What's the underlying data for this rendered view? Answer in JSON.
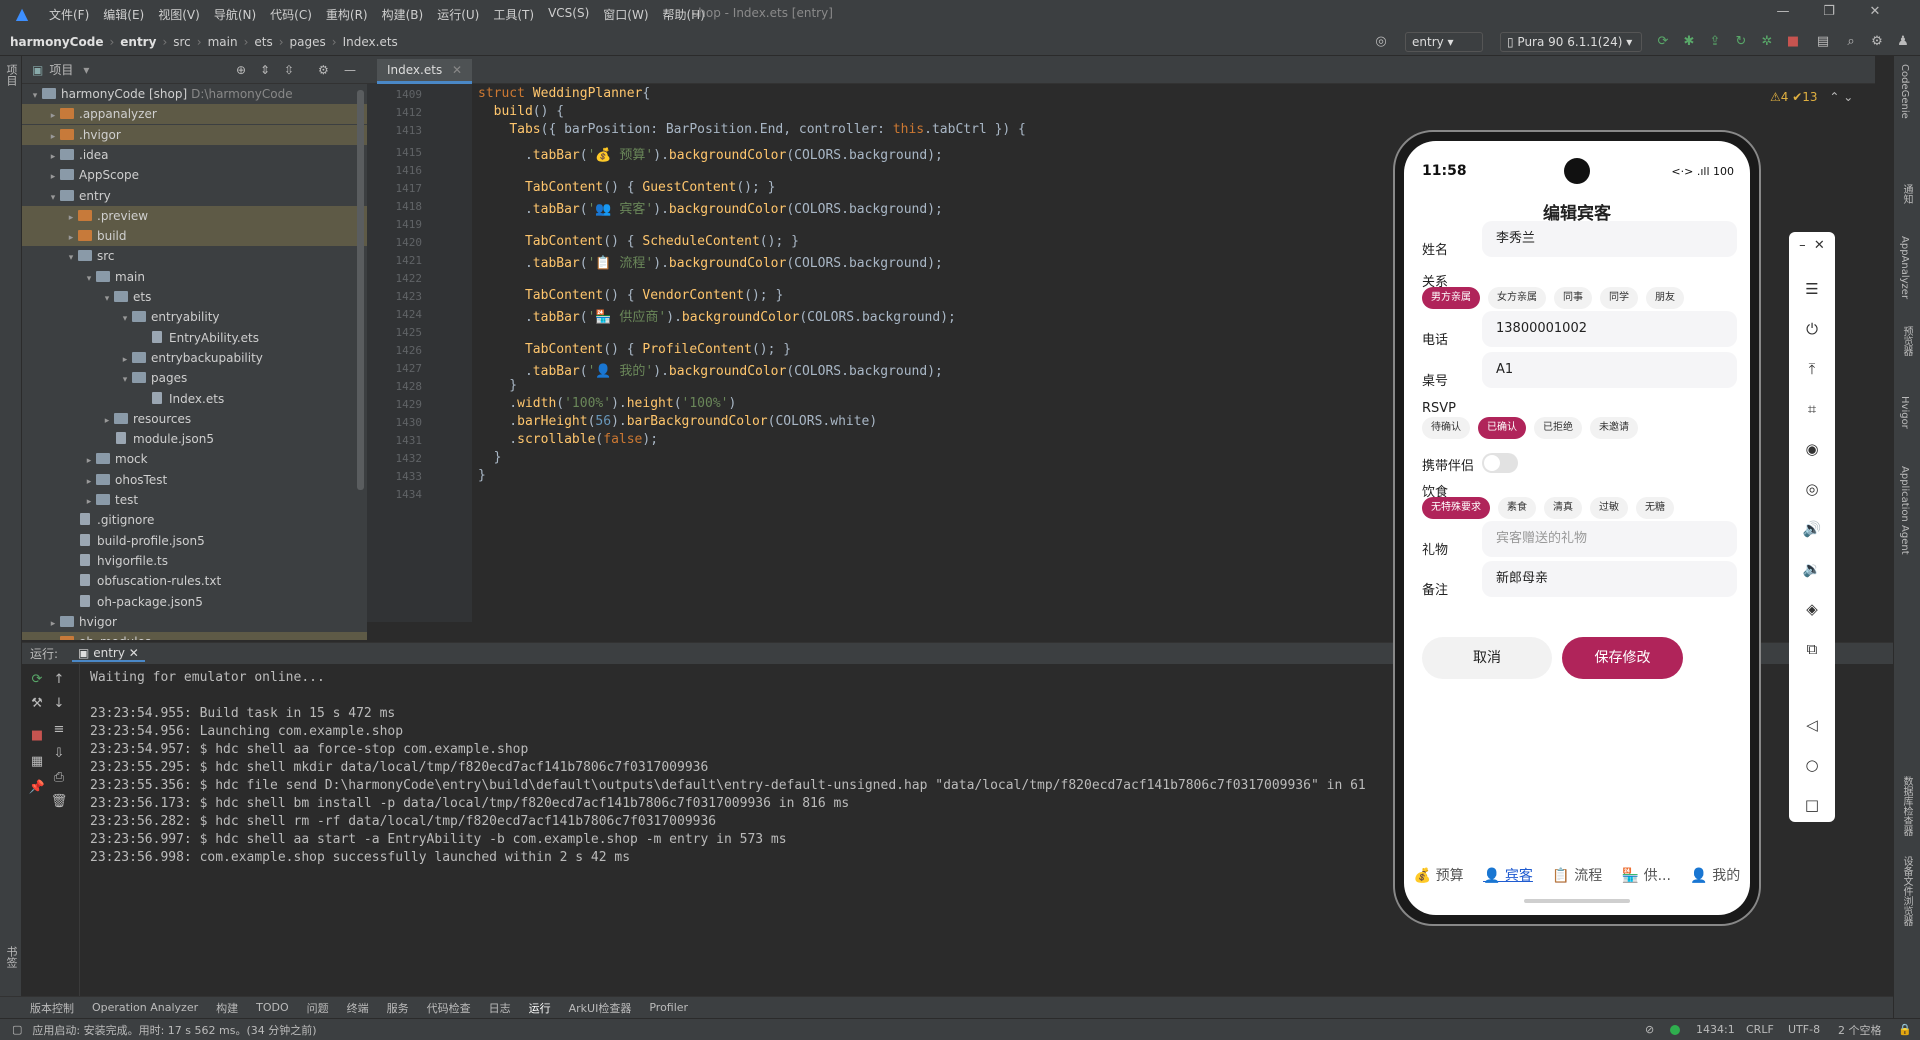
{
  "menu": {
    "items": [
      "文件(F)",
      "编辑(E)",
      "视图(V)",
      "导航(N)",
      "代码(C)",
      "重构(R)",
      "构建(B)",
      "运行(U)",
      "工具(T)",
      "VCS(S)",
      "窗口(W)",
      "帮助(H)"
    ],
    "title": "shop - Index.ets [entry]"
  },
  "nav": {
    "crumbs": [
      "harmonyCode",
      "entry",
      "src",
      "main",
      "ets",
      "pages",
      "Index.ets"
    ],
    "run_config": "entry",
    "device": "Pura 90 6.1.1(24)"
  },
  "left_strip": {
    "project": "项目",
    "bookmarks": "书签",
    "structure": "结构"
  },
  "project": {
    "header": "项目",
    "tree": [
      {
        "indent": 0,
        "arrow": "▾",
        "icon": "fold",
        "name": "harmonyCode [shop]",
        "extra": "D:\\harmonyCode",
        "hl": false
      },
      {
        "indent": 1,
        "arrow": "▸",
        "icon": "ofold",
        "name": ".appanalyzer",
        "hl": true
      },
      {
        "indent": 1,
        "arrow": "▸",
        "icon": "ofold",
        "name": ".hvigor",
        "hl": true
      },
      {
        "indent": 1,
        "arrow": "▸",
        "icon": "fold",
        "name": ".idea",
        "hl": false
      },
      {
        "indent": 1,
        "arrow": "▸",
        "icon": "fold",
        "name": "AppScope",
        "hl": false
      },
      {
        "indent": 1,
        "arrow": "▾",
        "icon": "fold",
        "name": "entry",
        "hl": false
      },
      {
        "indent": 2,
        "arrow": "▸",
        "icon": "ofold",
        "name": ".preview",
        "hl": true
      },
      {
        "indent": 2,
        "arrow": "▸",
        "icon": "ofold",
        "name": "build",
        "hl": true
      },
      {
        "indent": 2,
        "arrow": "▾",
        "icon": "fold",
        "name": "src",
        "hl": false
      },
      {
        "indent": 3,
        "arrow": "▾",
        "icon": "fold",
        "name": "main",
        "hl": false
      },
      {
        "indent": 4,
        "arrow": "▾",
        "icon": "fold",
        "name": "ets",
        "hl": false
      },
      {
        "indent": 5,
        "arrow": "▾",
        "icon": "fold",
        "name": "entryability",
        "hl": false
      },
      {
        "indent": 6,
        "arrow": "",
        "icon": "file",
        "name": "EntryAbility.ets",
        "hl": false
      },
      {
        "indent": 5,
        "arrow": "▸",
        "icon": "fold",
        "name": "entrybackupability",
        "hl": false
      },
      {
        "indent": 5,
        "arrow": "▾",
        "icon": "fold",
        "name": "pages",
        "hl": false
      },
      {
        "indent": 6,
        "arrow": "",
        "icon": "file",
        "name": "Index.ets",
        "hl": false
      },
      {
        "indent": 4,
        "arrow": "▸",
        "icon": "fold",
        "name": "resources",
        "hl": false
      },
      {
        "indent": 4,
        "arrow": "",
        "icon": "file",
        "name": "module.json5",
        "hl": false
      },
      {
        "indent": 3,
        "arrow": "▸",
        "icon": "fold",
        "name": "mock",
        "hl": false
      },
      {
        "indent": 3,
        "arrow": "▸",
        "icon": "fold",
        "name": "ohosTest",
        "hl": false
      },
      {
        "indent": 3,
        "arrow": "▸",
        "icon": "fold",
        "name": "test",
        "hl": false
      },
      {
        "indent": 2,
        "arrow": "",
        "icon": "file",
        "name": ".gitignore",
        "hl": false
      },
      {
        "indent": 2,
        "arrow": "",
        "icon": "file",
        "name": "build-profile.json5",
        "hl": false
      },
      {
        "indent": 2,
        "arrow": "",
        "icon": "file",
        "name": "hvigorfile.ts",
        "hl": false
      },
      {
        "indent": 2,
        "arrow": "",
        "icon": "file",
        "name": "obfuscation-rules.txt",
        "hl": false
      },
      {
        "indent": 2,
        "arrow": "",
        "icon": "file",
        "name": "oh-package.json5",
        "hl": false
      },
      {
        "indent": 1,
        "arrow": "▸",
        "icon": "fold",
        "name": "hvigor",
        "hl": false
      },
      {
        "indent": 1,
        "arrow": "▸",
        "icon": "ofold",
        "name": "oh_modules",
        "hl": true
      }
    ]
  },
  "editor": {
    "tab": "Index.ets",
    "inspections": "⚠4 ✔13",
    "line_numbers": [
      "1409",
      "1412",
      "1413",
      "1415",
      "1416",
      "1417",
      "1418",
      "1419",
      "1420",
      "1421",
      "1422",
      "1423",
      "1424",
      "1425",
      "1426",
      "1427",
      "1428",
      "1429",
      "1430",
      "1431",
      "1432",
      "1433",
      "1434"
    ],
    "lines": [
      [
        [
          "kw",
          "struct "
        ],
        [
          "fn",
          "WeddingPlanner"
        ],
        [
          "",
          "{"
        ]
      ],
      [
        [
          "",
          "  "
        ],
        [
          "fn",
          "build"
        ],
        [
          "",
          "() {"
        ]
      ],
      [
        [
          "",
          "    "
        ],
        [
          "fn",
          "Tabs"
        ],
        [
          "",
          "({ barPosition: BarPosition.End, controller: "
        ],
        [
          "kw",
          "this"
        ],
        [
          "",
          ".tabCtrl }) {"
        ]
      ],
      [
        [
          "",
          "      ."
        ],
        [
          "fn",
          "tabBar"
        ],
        [
          "",
          "("
        ],
        [
          "st",
          "'💰 预算'"
        ],
        [
          "",
          ")."
        ],
        [
          "fn",
          "backgroundColor"
        ],
        [
          "",
          "(COLORS.background);"
        ]
      ],
      [
        [
          "",
          ""
        ]
      ],
      [
        [
          "",
          "      "
        ],
        [
          "fn",
          "TabContent"
        ],
        [
          "",
          "() { "
        ],
        [
          "fn",
          "GuestContent"
        ],
        [
          "",
          "(); }"
        ]
      ],
      [
        [
          "",
          "      ."
        ],
        [
          "fn",
          "tabBar"
        ],
        [
          "",
          "("
        ],
        [
          "st",
          "'👥 宾客'"
        ],
        [
          "",
          ")."
        ],
        [
          "fn",
          "backgroundColor"
        ],
        [
          "",
          "(COLORS.background);"
        ]
      ],
      [
        [
          "",
          ""
        ]
      ],
      [
        [
          "",
          "      "
        ],
        [
          "fn",
          "TabContent"
        ],
        [
          "",
          "() { "
        ],
        [
          "fn",
          "ScheduleContent"
        ],
        [
          "",
          "(); }"
        ]
      ],
      [
        [
          "",
          "      ."
        ],
        [
          "fn",
          "tabBar"
        ],
        [
          "",
          "("
        ],
        [
          "st",
          "'📋 流程'"
        ],
        [
          "",
          ")."
        ],
        [
          "fn",
          "backgroundColor"
        ],
        [
          "",
          "(COLORS.background);"
        ]
      ],
      [
        [
          "",
          ""
        ]
      ],
      [
        [
          "",
          "      "
        ],
        [
          "fn",
          "TabContent"
        ],
        [
          "",
          "() { "
        ],
        [
          "fn",
          "VendorContent"
        ],
        [
          "",
          "(); }"
        ]
      ],
      [
        [
          "",
          "      ."
        ],
        [
          "fn",
          "tabBar"
        ],
        [
          "",
          "("
        ],
        [
          "st",
          "'🏪 供应商'"
        ],
        [
          "",
          ")."
        ],
        [
          "fn",
          "backgroundColor"
        ],
        [
          "",
          "(COLORS.background);"
        ]
      ],
      [
        [
          "",
          ""
        ]
      ],
      [
        [
          "",
          "      "
        ],
        [
          "fn",
          "TabContent"
        ],
        [
          "",
          "() { "
        ],
        [
          "fn",
          "ProfileContent"
        ],
        [
          "",
          "(); }"
        ]
      ],
      [
        [
          "",
          "      ."
        ],
        [
          "fn",
          "tabBar"
        ],
        [
          "",
          "("
        ],
        [
          "st",
          "'👤 我的'"
        ],
        [
          "",
          ")."
        ],
        [
          "fn",
          "backgroundColor"
        ],
        [
          "",
          "(COLORS.background);"
        ]
      ],
      [
        [
          "",
          "    }"
        ]
      ],
      [
        [
          "",
          "    ."
        ],
        [
          "fn",
          "width"
        ],
        [
          "",
          "("
        ],
        [
          "st",
          "'100%'"
        ],
        [
          "",
          ")."
        ],
        [
          "fn",
          "height"
        ],
        [
          "",
          "("
        ],
        [
          "st",
          "'100%'"
        ],
        [
          "",
          ")"
        ]
      ],
      [
        [
          "",
          "    ."
        ],
        [
          "fn",
          "barHeight"
        ],
        [
          "",
          "("
        ],
        [
          "nu",
          "56"
        ],
        [
          "",
          ")."
        ],
        [
          "fn",
          "barBackgroundColor"
        ],
        [
          "",
          "(COLORS.white)"
        ]
      ],
      [
        [
          "",
          "    ."
        ],
        [
          "fn",
          "scrollable"
        ],
        [
          "",
          "("
        ],
        [
          "kw",
          "false"
        ],
        [
          "",
          ");"
        ]
      ],
      [
        [
          "",
          "  }"
        ]
      ],
      [
        [
          "",
          "}"
        ]
      ],
      [
        [
          "",
          ""
        ]
      ]
    ]
  },
  "run": {
    "label": "运行:",
    "tab": "entry",
    "console": [
      "Waiting for emulator online...",
      "",
      "23:23:54.955: Build task in 15 s 472 ms",
      "23:23:54.956: Launching com.example.shop",
      "23:23:54.957: $ hdc shell aa force-stop com.example.shop",
      "23:23:55.295: $ hdc shell mkdir data/local/tmp/f820ecd7acf141b7806c7f0317009936",
      "23:23:55.356: $ hdc file send D:\\harmonyCode\\entry\\build\\default\\outputs\\default\\entry-default-unsigned.hap \"data/local/tmp/f820ecd7acf141b7806c7f0317009936\" in 61",
      "23:23:56.173: $ hdc shell bm install -p data/local/tmp/f820ecd7acf141b7806c7f0317009936 in 816 ms",
      "23:23:56.282: $ hdc shell rm -rf data/local/tmp/f820ecd7acf141b7806c7f0317009936",
      "23:23:56.997: $ hdc shell aa start -a EntryAbility -b com.example.shop -m entry in 573 ms",
      "23:23:56.998: com.example.shop successfully launched within 2 s 42 ms"
    ]
  },
  "bottom_tabs": [
    "版本控制",
    "Operation Analyzer",
    "构建",
    "TODO",
    "问题",
    "终端",
    "服务",
    "代码检查",
    "日志",
    "运行",
    "ArkUI检查器",
    "Profiler"
  ],
  "status": {
    "message": "应用启动: 安装完成。用时: 17 s 562 ms。(34 分钟之前)",
    "position": "1434:1",
    "eol": "CRLF",
    "encoding": "UTF-8",
    "indent": "2 个空格"
  },
  "right_strip": [
    "CodeGenie",
    "通知",
    "AppAnalyzer",
    "预览器",
    "Hvigor",
    "Application Agent",
    "数据库检查器",
    "设备文件浏览器"
  ],
  "phone": {
    "time": "11:58",
    "status_icons": "<·> .ıll 100",
    "title": "编辑宾客",
    "name_label": "姓名",
    "name_value": "李秀兰",
    "relation_label": "关系",
    "relations": [
      "男方亲属",
      "女方亲属",
      "同事",
      "同学",
      "朋友"
    ],
    "relation_selected": 0,
    "phone_label": "电话",
    "phone_value": "13800001002",
    "table_label": "桌号",
    "table_value": "A1",
    "rsvp_label": "RSVP",
    "rsvp": [
      "待确认",
      "已确认",
      "已拒绝",
      "未邀请"
    ],
    "rsvp_selected": 1,
    "partner_label": "携带伴侣",
    "partner_on": false,
    "diet_label": "饮食",
    "diets": [
      "无特殊要求",
      "素食",
      "清真",
      "过敏",
      "无糖"
    ],
    "diet_selected": 0,
    "gift_label": "礼物",
    "gift_placeholder": "宾客赠送的礼物",
    "note_label": "备注",
    "note_value": "新郎母亲",
    "cancel": "取消",
    "save": "保存修改",
    "accent": "#b0245a",
    "tabs": [
      "💰 预算",
      "👤 宾客",
      "📋 流程",
      "🏪 供...",
      "👤 我的"
    ],
    "tab_selected": 1
  }
}
